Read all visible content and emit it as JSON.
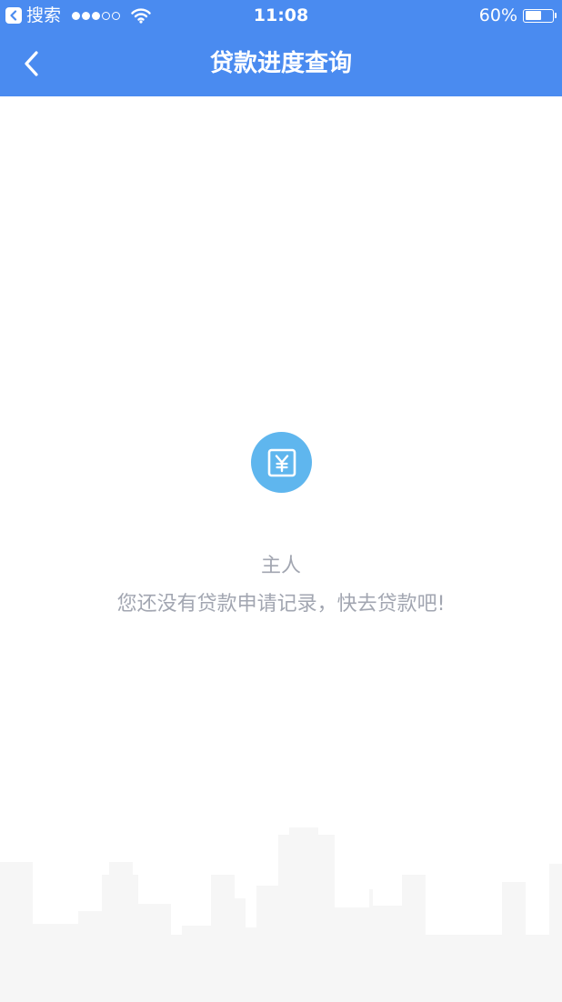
{
  "status_bar": {
    "back_app_label": "搜索",
    "signal_bars_filled": 3,
    "signal_bars_total": 5,
    "time": "11:08",
    "battery_percent_text": "60%",
    "battery_level": 0.6
  },
  "nav": {
    "title": "贷款进度查询"
  },
  "empty_state": {
    "icon": "yen-document-icon",
    "title": "主人",
    "message": "您还没有贷款申请记录，快去贷款吧!"
  },
  "colors": {
    "primary": "#4a8bf0",
    "icon_circle": "#5fb6ee",
    "muted_text": "#a2a6b1",
    "skyline": "#f6f6f6"
  }
}
